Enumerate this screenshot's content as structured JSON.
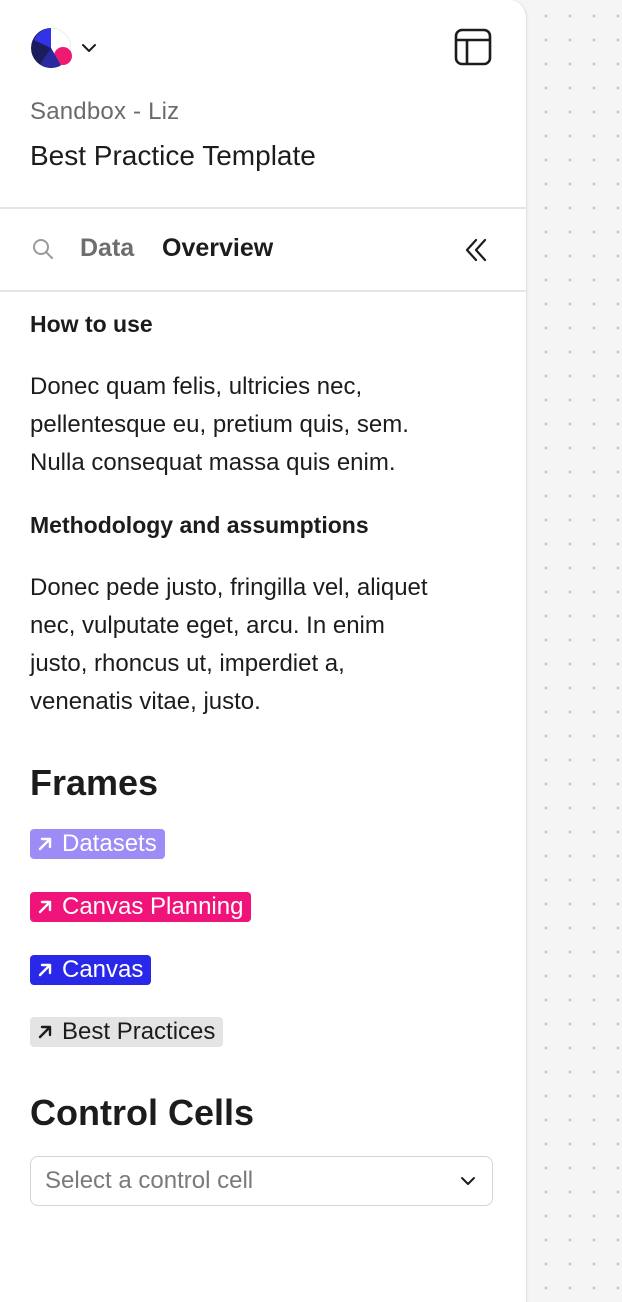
{
  "header": {
    "workspace": "Sandbox - Liz",
    "title": "Best Practice Template"
  },
  "tabs": [
    {
      "label": "Data",
      "active": false
    },
    {
      "label": "Overview",
      "active": true
    }
  ],
  "sections": [
    {
      "heading": "How to use",
      "lines": [
        "Donec quam felis, ultricies nec,",
        "pellentesque eu, pretium quis, sem.",
        "Nulla consequat massa quis enim."
      ]
    },
    {
      "heading": "Methodology and assumptions",
      "lines": [
        "Donec pede justo, fringilla vel, aliquet",
        "nec, vulputate eget, arcu. In enim",
        "justo, rhoncus ut, imperdiet a,",
        "venenatis vitae, justo."
      ]
    }
  ],
  "frames": {
    "heading": "Frames",
    "items": [
      {
        "label": "Datasets",
        "bg": "#9e8cf6",
        "fg": "#ffffff"
      },
      {
        "label": "Canvas Planning",
        "bg": "#f0137a",
        "fg": "#ffffff"
      },
      {
        "label": "Canvas",
        "bg": "#2a28e8",
        "fg": "#ffffff"
      },
      {
        "label": "Best Practices",
        "bg": "#e4e4e4",
        "fg": "#1c1c1e"
      }
    ]
  },
  "control_cells": {
    "heading": "Control Cells",
    "placeholder": "Select a control cell"
  },
  "icons": {
    "logo": "app-logo-icon",
    "logo_menu": "chevron-down-icon",
    "layout": "layout-panel-icon",
    "search": "search-icon",
    "collapse": "chevrons-left-icon",
    "frame_link": "arrow-up-right-icon",
    "select": "chevron-down-icon"
  },
  "colors": {
    "logo_navy": "#1a1f5c",
    "logo_blue": "#3232e6",
    "logo_pink": "#ee1a72"
  }
}
